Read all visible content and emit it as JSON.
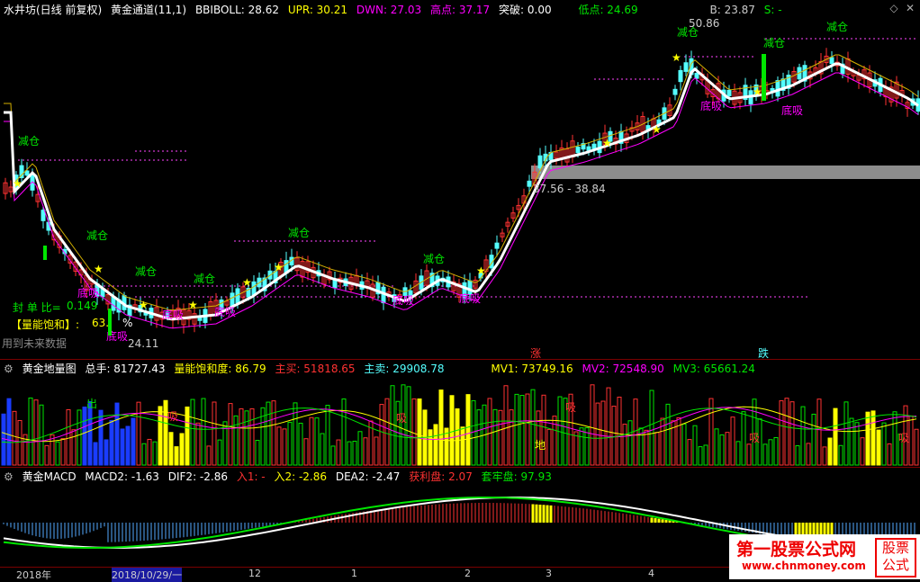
{
  "header": {
    "stock_name": "水井坊(日线 前复权)",
    "indicator_name": "黄金通道(11,1)",
    "bbiboll": "BBIBOLL: 28.62",
    "upr": "UPR: 30.21",
    "dwn": "DWN: 27.03",
    "high": "高点: 37.17",
    "breakout": "突破: 0.00",
    "low": "低点: 24.69",
    "b": "B: 23.87",
    "s": "S: -"
  },
  "main_labels": {
    "reduce": "减仓",
    "absorb": "底吸",
    "seal_ratio_label": "封 单 比=",
    "seal_ratio_value": "0.149",
    "saturation_label": "【量能饱和】:",
    "saturation_value": "63.",
    "percent": "%",
    "future_data_note": "用到未来数据",
    "low_value": "24.11",
    "peak_value": "50.86",
    "range_label": "37.56 - 38.84",
    "up_flag": "涨",
    "down_flag": "跌"
  },
  "volume_panel": {
    "title": "黄金地量图",
    "total": "总手: 81727.43",
    "saturation": "量能饱和度: 86.79",
    "buy": "主买: 51818.65",
    "sell": "主卖: 29908.78",
    "mv1": "MV1: 73749.16",
    "mv2": "MV2: 72548.90",
    "mv3": "MV3: 65661.24",
    "out_label": "出",
    "absorb_label": "吸",
    "ground_label": "地"
  },
  "macd_panel": {
    "title": "黄金MACD",
    "macd2": "MACD2: -1.63",
    "dif2": "DIF2: -2.86",
    "in1": "入1: -",
    "in2": "入2: -2.86",
    "dea2": "DEA2: -2.47",
    "profit": "获利盘: 2.07",
    "trapped": "套牢盘: 97.93"
  },
  "time_axis": {
    "labels": [
      "2018年",
      "2018/10/29/一",
      "12",
      "1",
      "2",
      "3",
      "4"
    ]
  },
  "watermark": {
    "title": "第一股票公式网",
    "url": "www.chnmoney.com",
    "badge": "股票公式"
  },
  "colors": {
    "bg": "#000000",
    "up": "#ff3232",
    "down": "#54ffff",
    "yellow": "#ffff00",
    "green": "#00e600",
    "magenta": "#ff00ff",
    "gray_band": "#8c8c8c"
  }
}
